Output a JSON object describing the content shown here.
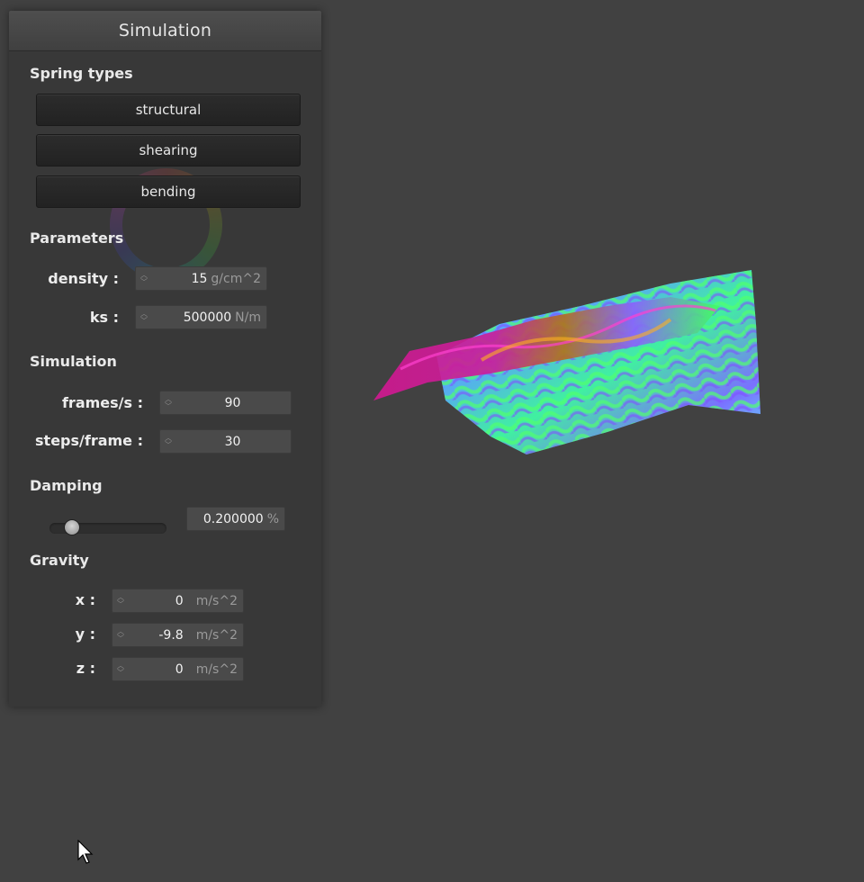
{
  "panel": {
    "title": "Simulation"
  },
  "spring_types": {
    "heading": "Spring types",
    "buttons": [
      "structural",
      "shearing",
      "bending"
    ]
  },
  "parameters": {
    "heading": "Parameters",
    "density": {
      "label": "density :",
      "value": "15",
      "unit": "g/cm^2"
    },
    "ks": {
      "label": "ks :",
      "value": "500000",
      "unit": "N/m"
    }
  },
  "simulation": {
    "heading": "Simulation",
    "fps": {
      "label": "frames/s :",
      "value": "90"
    },
    "steps": {
      "label": "steps/frame :",
      "value": "30"
    }
  },
  "damping": {
    "heading": "Damping",
    "value": "0.200000",
    "unit": "%",
    "slider_fraction": 0.2
  },
  "gravity": {
    "heading": "Gravity",
    "x": {
      "label": "x :",
      "value": "0",
      "unit": "m/s^2"
    },
    "y": {
      "label": "y :",
      "value": "-9.8",
      "unit": "m/s^2"
    },
    "z": {
      "label": "z :",
      "value": "0",
      "unit": "m/s^2"
    }
  },
  "colors": {
    "background": "#414141",
    "panel": "#383838",
    "button": "#262626",
    "field": "#4a4a4a"
  }
}
